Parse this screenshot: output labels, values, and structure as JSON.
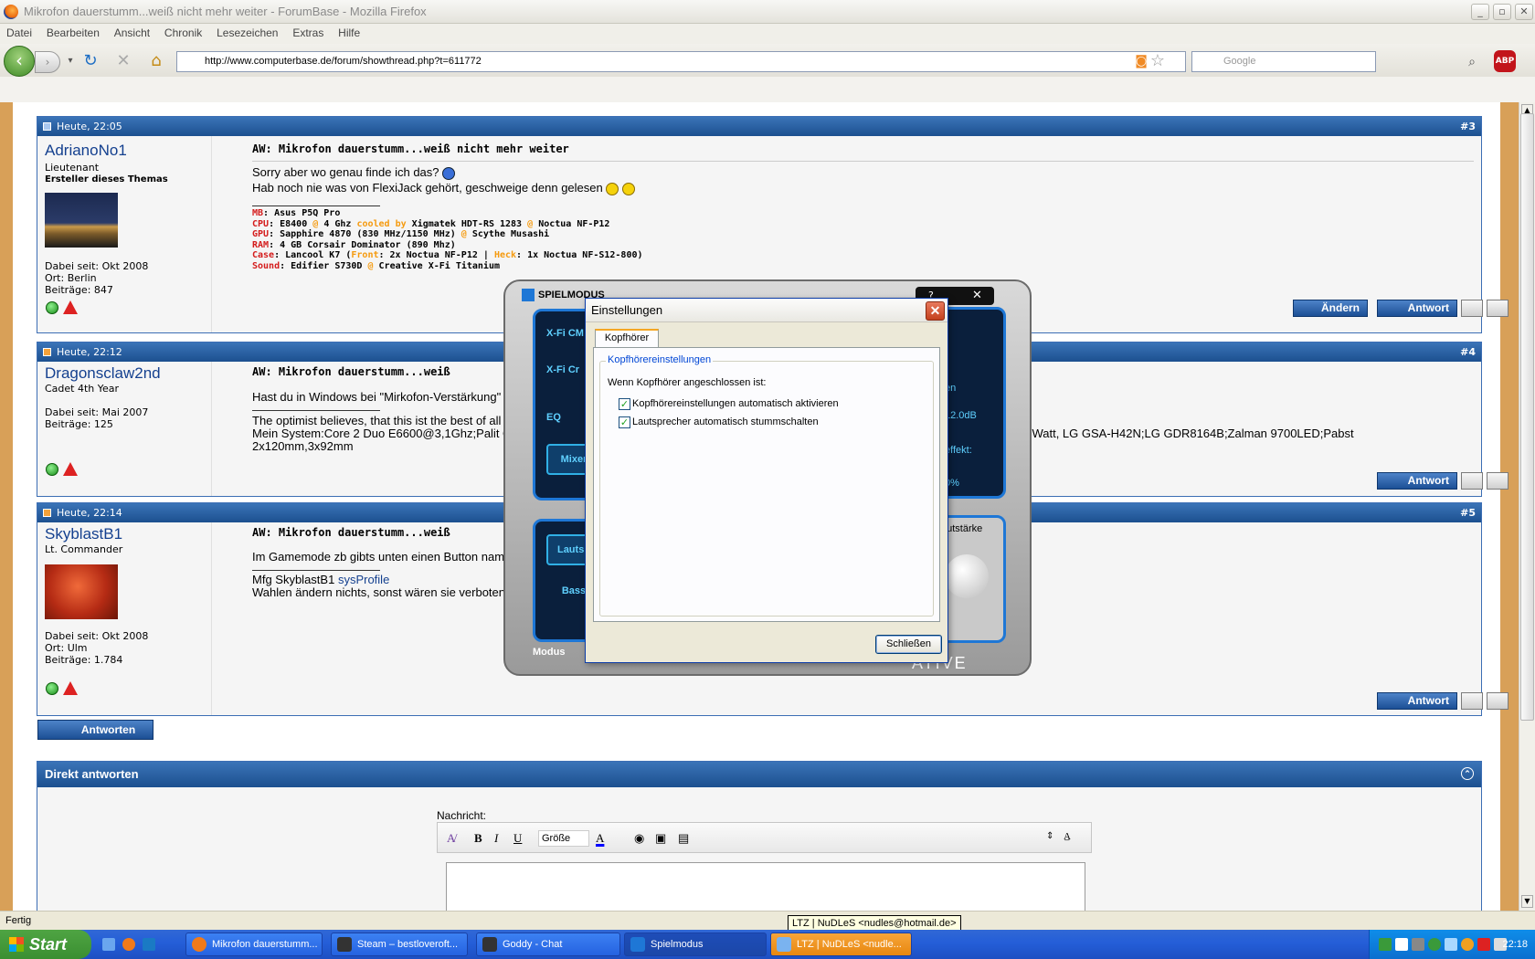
{
  "window": {
    "title": "Mikrofon dauerstumm...weiß nicht mehr weiter - ForumBase - Mozilla Firefox"
  },
  "menu": [
    "Datei",
    "Bearbeiten",
    "Ansicht",
    "Chronik",
    "Lesezeichen",
    "Extras",
    "Hilfe"
  ],
  "nav": {
    "url": "http://www.computerbase.de/forum/showthread.php?t=611772",
    "search_placeholder": "Google",
    "abp": "ABP"
  },
  "posts": [
    {
      "date": "Heute, 22:05",
      "num": "#3",
      "user": "AdrianoNo1",
      "rank": "Lieutenant",
      "extra": "Ersteller dieses Themas",
      "joined": "Dabei seit: Okt 2008",
      "location": "Ort: Berlin",
      "count": "Beiträge: 847",
      "title": "AW: Mikrofon dauerstumm...weiß nicht mehr weiter",
      "lines": [
        "Sorry aber wo genau finde ich das?",
        "Hab noch nie was von FlexiJack gehört, geschweige denn gelesen"
      ],
      "sig": [
        {
          "k": "MB",
          "v": "Asus P5Q Pro"
        },
        {
          "k": "CPU",
          "v": "E8400",
          "a": "@",
          "b": "4 Ghz",
          "c": "cooled by",
          "d": "Xigmatek HDT-RS 1283",
          "e": "@",
          "f": "Noctua NF-P12"
        },
        {
          "k": "GPU",
          "v": "Sapphire 4870 (830 MHz/1150 MHz)",
          "a": "@",
          "b": "Scythe Musashi"
        },
        {
          "k": "RAM",
          "v": "4 GB Corsair Dominator (890 Mhz)"
        },
        {
          "k": "Case",
          "v": "Lancool K7 (",
          "a": "Front",
          "b": ": 2x Noctua NF-P12 |",
          "c": "Heck",
          "d": ": 1x Noctua NF-S12-800)"
        },
        {
          "k": "Sound",
          "v": "Edifier S730D",
          "a": "@",
          "b": "Creative X-Fi Titanium"
        }
      ],
      "buttons": [
        "Ändern",
        "Antwort"
      ]
    },
    {
      "date": "Heute, 22:12",
      "num": "#4",
      "user": "Dragonsclaw2nd",
      "rank": "Cadet 4th Year",
      "joined": "Dabei seit: Mai 2007",
      "count": "Beiträge: 125",
      "title": "AW: Mikrofon dauerstumm...weiß",
      "lines": [
        "Hast du in Windows bei \"Mirkofon-Verstärkung\" ne",
        "The optimist believes, that this ist the best of all p",
        "Mein System:Core 2 Duo E6600@3,1Ghz;Palit GTX",
        "2x120mm,3x92mm"
      ],
      "line_right": "50Watt, LG GSA-H42N;LG GDR8164B;Zalman 9700LED;Pabst",
      "buttons": [
        "Antwort"
      ]
    },
    {
      "date": "Heute, 22:14",
      "num": "#5",
      "user": "SkyblastB1",
      "rank": "Lt. Commander",
      "joined": "Dabei seit: Okt 2008",
      "location": "Ort: Ulm",
      "count": "Beiträge: 1.784",
      "title": "AW: Mikrofon dauerstumm...weiß",
      "lines": [
        "Im Gamemode zb gibts unten einen Button namen",
        "Wahlen ändern nichts, sonst wären sie verboten."
      ],
      "mfg": "Mfg SkyblastB1",
      "link": "sysProfile",
      "buttons": [
        "Antwort"
      ]
    }
  ],
  "antworten_button": "Antworten",
  "direct": {
    "title": "Direkt antworten",
    "label": "Nachricht:",
    "size": "Größe",
    "bold": "B",
    "italic": "I",
    "underline": "U"
  },
  "status": "Fertig",
  "tooltip": "LTZ | NuDLeS <nudles@hotmail.de>",
  "creative": {
    "title": "SPIELMODUS",
    "left_items": [
      "X-Fi CM",
      "X-Fi Cr",
      "EQ",
      "Mixer",
      "Lautsp",
      "Bass"
    ],
    "modus": "Modus",
    "right_texts": [
      "en",
      "12.0dB",
      "effekt:",
      "0%",
      "autstärke"
    ],
    "brand": "ATIVE",
    "help": "?",
    "close": "✕"
  },
  "dialog": {
    "title": "Einstellungen",
    "tab": "Kopfhörer",
    "group": "Kopfhörereinstellungen",
    "when": "Wenn Kopfhörer angeschlossen ist:",
    "options": [
      {
        "label": "Kopfhörereinstellungen automatisch aktivieren",
        "checked": true
      },
      {
        "label": "Lautsprecher automatisch stummschalten",
        "checked": true
      }
    ],
    "close_button": "Schließen"
  },
  "taskbar": {
    "start": "Start",
    "buttons": [
      "Mikrofon dauerstumm...",
      "Steam – bestloveroft...",
      "Goddy - Chat",
      "Spielmodus",
      "LTZ | NuDLeS <nudle..."
    ],
    "clock": "22:18"
  }
}
